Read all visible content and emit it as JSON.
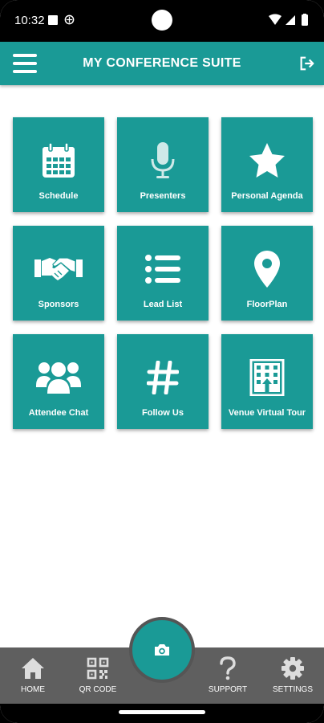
{
  "status_bar": {
    "time": "10:32"
  },
  "app_bar": {
    "title": "MY CONFERENCE SUITE"
  },
  "colors": {
    "primary": "#1a9a96",
    "nav_background": "#5f5f5f",
    "background": "#ffffff"
  },
  "tiles": [
    {
      "label": "Schedule",
      "icon": "calendar-icon"
    },
    {
      "label": "Presenters",
      "icon": "microphone-icon"
    },
    {
      "label": "Personal Agenda",
      "icon": "star-icon"
    },
    {
      "label": "Sponsors",
      "icon": "handshake-icon"
    },
    {
      "label": "Lead List",
      "icon": "list-icon"
    },
    {
      "label": "FloorPlan",
      "icon": "map-pin-icon"
    },
    {
      "label": "Attendee Chat",
      "icon": "users-icon"
    },
    {
      "label": "Follow Us",
      "icon": "hashtag-icon"
    },
    {
      "label": "Venue Virtual Tour",
      "icon": "building-icon"
    }
  ],
  "bottom_nav": {
    "items": [
      {
        "label": "HOME",
        "icon": "home-icon"
      },
      {
        "label": "QR CODE",
        "icon": "qr-code-icon"
      },
      {
        "label": "SUPPORT",
        "icon": "question-icon"
      },
      {
        "label": "SETTINGS",
        "icon": "gear-icon"
      }
    ],
    "fab_icon": "camera-icon"
  }
}
